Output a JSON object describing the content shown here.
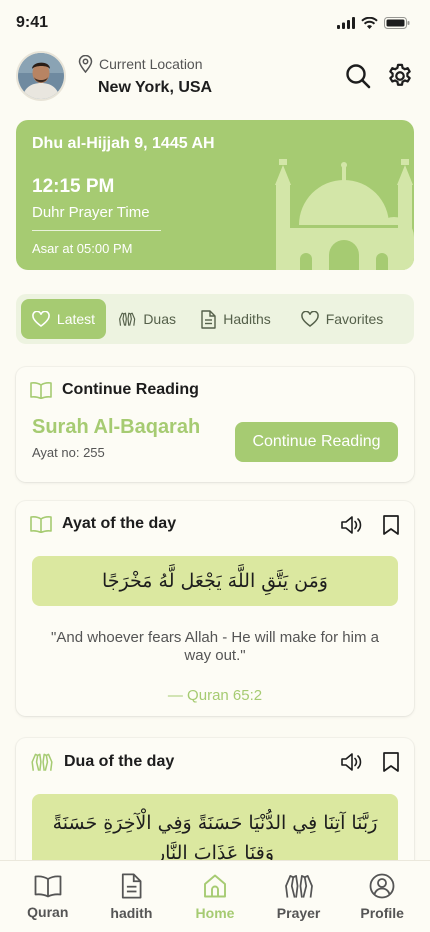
{
  "status_bar": {
    "time": "9:41"
  },
  "header": {
    "location_label": "Current Location",
    "location_city": "New York, USA"
  },
  "hero": {
    "hijri_date": "Dhu al-Hijjah 9, 1445 AH",
    "prayer_time": "12:15 PM",
    "prayer_name": "Duhr Prayer Time",
    "next_prayer": "Asar at 05:00 PM"
  },
  "tabs": [
    {
      "label": "Latest",
      "icon": "heart-icon",
      "active": true
    },
    {
      "label": "Duas",
      "icon": "praying-hands-icon",
      "active": false
    },
    {
      "label": "Hadiths",
      "icon": "document-icon",
      "active": false
    },
    {
      "label": "Favorites",
      "icon": "heart-icon",
      "active": false
    }
  ],
  "continue_reading": {
    "title": "Continue Reading",
    "surah": "Surah Al-Baqarah",
    "ayat": "Ayat no: 255",
    "button_label": "Continue Reading"
  },
  "ayat_of_day": {
    "title": "Ayat of the day",
    "arabic": "وَمَن يَتَّقِ اللَّهَ يَجْعَل لَّهُ مَخْرَجًا",
    "translation": "\"And whoever fears Allah - He will make for him a way out.\"",
    "reference": "— Quran 65:2"
  },
  "dua_of_day": {
    "title": "Dua of the day",
    "arabic": "رَبَّنَا آتِنَا فِي الدُّنْيَا حَسَنَةً وَفِي الْآخِرَةِ حَسَنَةً وَقِنَا عَذَابَ النَّارِ"
  },
  "bottom_nav": [
    {
      "label": "Quran",
      "icon": "book-icon",
      "active": false
    },
    {
      "label": "hadith",
      "icon": "document-icon",
      "active": false
    },
    {
      "label": "Home",
      "icon": "home-icon",
      "active": true
    },
    {
      "label": "Prayer",
      "icon": "praying-hands-icon",
      "active": false
    },
    {
      "label": "Profile",
      "icon": "user-circle-icon",
      "active": false
    }
  ],
  "colors": {
    "accent": "#a6cb72",
    "accent_light": "#dbe8a0",
    "background": "#fcfbf3",
    "tab_bg": "#edf3e0"
  }
}
